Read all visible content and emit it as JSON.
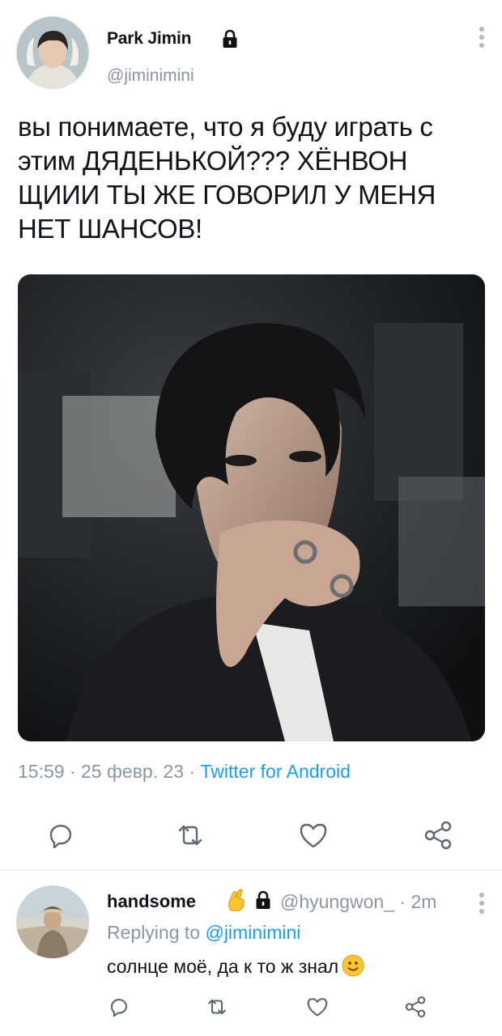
{
  "tweet": {
    "author_name": "Park Jimin",
    "author_handle": "@jiminimini",
    "text": "вы понимаете, что я буду играть с этим ДЯДЕНЬКОЙ??? ХЁНВОН ЩИИИ ТЫ ЖЕ ГОВОРИЛ У МЕНЯ НЕТ ШАНСОВ!",
    "time": "15:59",
    "date": "25 февр. 23",
    "separator": " · ",
    "source": "Twitter for Android",
    "icons": {
      "lock": "lock-icon",
      "more": "more-vertical-icon",
      "reply": "reply-icon",
      "retweet": "retweet-icon",
      "like": "heart-icon",
      "share": "share-icon"
    }
  },
  "reply": {
    "author_name": "handsome",
    "author_emoji": "crossed-fingers-emoji",
    "author_handle": "@hyungwon_",
    "separator": " · ",
    "time_ago": "2m",
    "replying_label": "Replying to",
    "replying_mention": "@jiminimini",
    "text": "солнце моё, да к то ж знал",
    "text_emoji": "slightly-smiling-face-emoji"
  },
  "colors": {
    "text": "#0f1419",
    "secondary": "#8a97a3",
    "link": "#1d9bf0",
    "divider": "#eff3f4"
  }
}
